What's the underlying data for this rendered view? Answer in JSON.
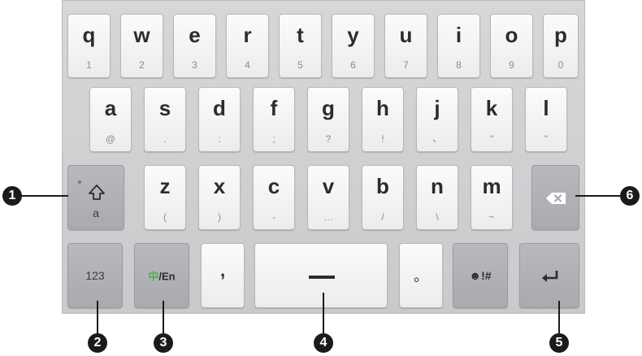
{
  "keyboard": {
    "row1": [
      {
        "main": "q",
        "sub": "1"
      },
      {
        "main": "w",
        "sub": "2"
      },
      {
        "main": "e",
        "sub": "3"
      },
      {
        "main": "r",
        "sub": "4"
      },
      {
        "main": "t",
        "sub": "5"
      },
      {
        "main": "y",
        "sub": "6"
      },
      {
        "main": "u",
        "sub": "7"
      },
      {
        "main": "i",
        "sub": "8"
      },
      {
        "main": "o",
        "sub": "9"
      },
      {
        "main": "p",
        "sub": "0"
      }
    ],
    "row2": [
      {
        "main": "a",
        "sub": "@"
      },
      {
        "main": "s",
        "sub": "."
      },
      {
        "main": "d",
        "sub": ":"
      },
      {
        "main": "f",
        "sub": ";"
      },
      {
        "main": "g",
        "sub": "?"
      },
      {
        "main": "h",
        "sub": "!"
      },
      {
        "main": "j",
        "sub": "、"
      },
      {
        "main": "k",
        "sub": "\""
      },
      {
        "main": "l",
        "sub": "\""
      }
    ],
    "row3": [
      {
        "main": "z",
        "sub": "("
      },
      {
        "main": "x",
        "sub": ")"
      },
      {
        "main": "c",
        "sub": "-"
      },
      {
        "main": "v",
        "sub": "…"
      },
      {
        "main": "b",
        "sub": "/"
      },
      {
        "main": "n",
        "sub": "\\"
      },
      {
        "main": "m",
        "sub": "~"
      }
    ],
    "shift_sub": "a",
    "numbers_label": "123",
    "lang_zh": "中",
    "lang_en": "/En",
    "comma": ",",
    "period": "。",
    "symbols_label": "!#",
    "accent_color": "#4caf50"
  },
  "callouts": [
    "1",
    "2",
    "3",
    "4",
    "5",
    "6"
  ]
}
